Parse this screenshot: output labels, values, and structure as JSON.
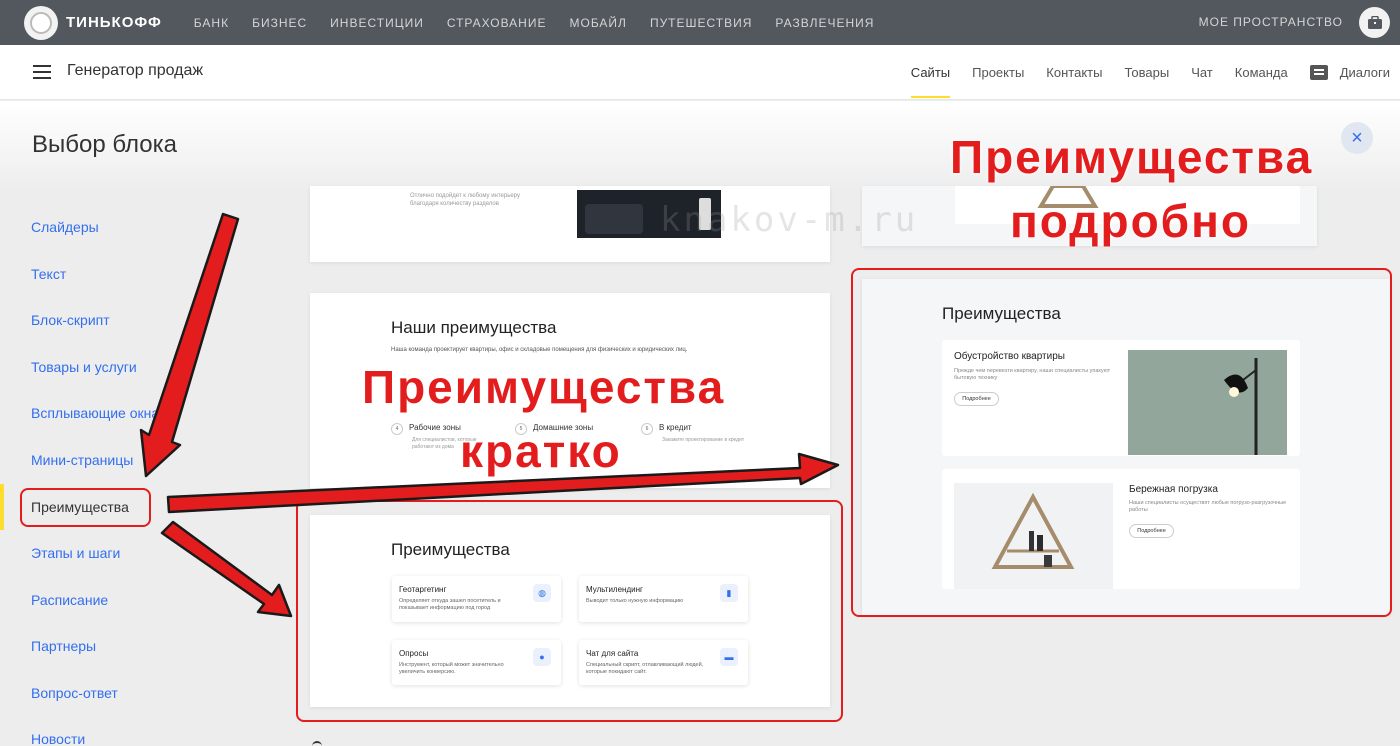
{
  "topbar": {
    "logo_text": "ТИНЬКОФФ",
    "nav": [
      "БАНК",
      "БИЗНЕС",
      "ИНВЕСТИЦИИ",
      "СТРАХОВАНИЕ",
      "МОБАЙЛ",
      "ПУТЕШЕСТВИЯ",
      "РАЗВЛЕЧЕНИЯ"
    ],
    "my_space": "МОЕ ПРОСТРАНСТВО"
  },
  "header": {
    "title": "Генератор продаж",
    "nav": [
      "Сайты",
      "Проекты",
      "Контакты",
      "Товары",
      "Чат",
      "Команда"
    ],
    "dialogs": "Диалоги",
    "active_index": 0
  },
  "page": {
    "title": "Выбор блока",
    "close": "×"
  },
  "sidebar": {
    "items": [
      "Слайдеры",
      "Текст",
      "Блок-скрипт",
      "Товары и услуги",
      "Всплывающие окна",
      "Мини-страницы",
      "Преимущества",
      "Этапы и шаги",
      "Расписание",
      "Партнеры",
      "Вопрос-ответ",
      "Новости"
    ],
    "selected_index": 6
  },
  "previews": {
    "top_text": "Отлично подойдет к любому интерьеру благодаря количеству разделов",
    "ours": {
      "title": "Наши преимущества",
      "subtitle": "Наша команда проектирует квартиры, офис и складовые помещения для физических и юридических лиц.",
      "items": [
        {
          "num": "4",
          "label": "Рабочие зоны",
          "desc": "Для специалистов, которые работают из дома"
        },
        {
          "num": "5",
          "label": "Домашние зоны",
          "desc": ""
        },
        {
          "num": "6",
          "label": "В кредит",
          "desc": "Закажите проектирование в кредит"
        }
      ]
    },
    "short": {
      "title": "Преимущества",
      "cards": [
        {
          "title": "Геотаргетинг",
          "desc": "Определяет откуда зашел посетитель и показывает информацию под город",
          "icon": "globe-icon",
          "glyph": "◍"
        },
        {
          "title": "Мультилендинг",
          "desc": "Выводит только нужную информацию",
          "icon": "bar-chart-icon",
          "glyph": "▮"
        },
        {
          "title": "Опросы",
          "desc": "Инструмент, который может значительно увеличить конверсию.",
          "icon": "users-icon",
          "glyph": "●"
        },
        {
          "title": "Чат для сайта",
          "desc": "Специальный скрипт, отлавливающий людей, которые покидают сайт.",
          "icon": "chat-icon",
          "glyph": "▬"
        }
      ]
    },
    "detailed": {
      "title": "Преимущества",
      "cards": [
        {
          "title": "Обустройство квартиры",
          "desc": "Прежде чем перевезти квартиру, наши специалисты упакуют бытовую технику",
          "button": "Подробнее"
        },
        {
          "title": "Бережная погрузка",
          "desc": "Наши специалисты осуществят любые погрузо-разгрузочные работы",
          "button": "Подробнее"
        }
      ]
    }
  },
  "annotations": {
    "short_line1": "Преимущества",
    "short_line2": "кратко",
    "detailed_line1": "Преимущества",
    "detailed_line2": "подробно",
    "watermark": "knakov-m.ru"
  },
  "colors": {
    "topbar": "#53585e",
    "accent_yellow": "#ffdd2d",
    "link_blue": "#336fee",
    "annotation_red": "#e31d1d"
  }
}
